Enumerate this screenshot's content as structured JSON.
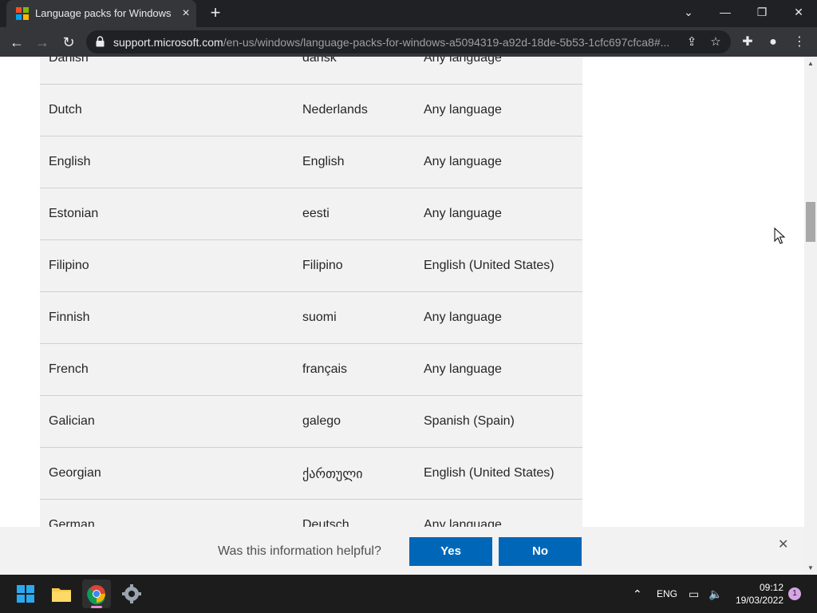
{
  "browser": {
    "tab_title": "Language packs for Windows",
    "url_host": "support.microsoft.com",
    "url_path": "/en-us/windows/language-packs-for-windows-a5094319-a92d-18de-5b53-1cfc697cfca8#..."
  },
  "icons": {
    "tab_close": "×",
    "new_tab": "+",
    "minimize": "—",
    "restore": "❐",
    "close": "✕",
    "dropdown": "⌄",
    "back": "←",
    "forward": "→",
    "reload": "↻",
    "share": "⇪",
    "star": "☆",
    "extensions": "✚",
    "profile": "●",
    "menu": "⋮",
    "scroll_up": "▲",
    "scroll_down": "▼",
    "feedback_close": "✕",
    "tray_chevron": "⌃",
    "network": "▭",
    "volume": "🔈"
  },
  "languages": {
    "rows": [
      {
        "language": "Danish",
        "native": "dansk",
        "base": "Any language"
      },
      {
        "language": "Dutch",
        "native": "Nederlands",
        "base": "Any language"
      },
      {
        "language": "English",
        "native": "English",
        "base": "Any language"
      },
      {
        "language": "Estonian",
        "native": "eesti",
        "base": "Any language"
      },
      {
        "language": "Filipino",
        "native": "Filipino",
        "base": "English (United States)"
      },
      {
        "language": "Finnish",
        "native": "suomi",
        "base": "Any language"
      },
      {
        "language": "French",
        "native": "français",
        "base": "Any language"
      },
      {
        "language": "Galician",
        "native": "galego",
        "base": "Spanish (Spain)"
      },
      {
        "language": "Georgian",
        "native": "ქართული",
        "base": "English (United States)"
      },
      {
        "language": "German",
        "native": "Deutsch",
        "base": "Any language"
      }
    ]
  },
  "feedback": {
    "question": "Was this information helpful?",
    "yes_label": "Yes",
    "no_label": "No"
  },
  "taskbar": {
    "input_language": "ENG",
    "time": "09:12",
    "date": "19/03/2022",
    "notification_count": "1"
  },
  "colors": {
    "accent": "#0067b8",
    "chrome_dark": "#202124",
    "chrome_toolbar": "#35363a",
    "row_bg": "#f2f2f2"
  }
}
